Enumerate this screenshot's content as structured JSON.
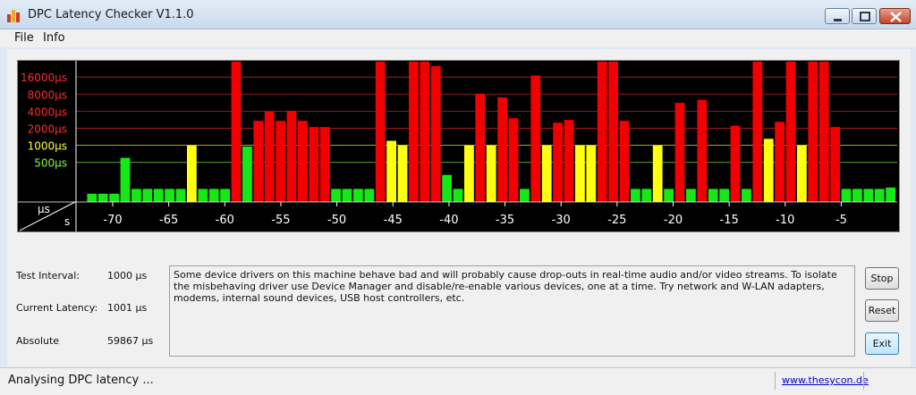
{
  "window": {
    "title": "DPC Latency Checker V1.1.0"
  },
  "menu": {
    "items": [
      {
        "label": "File"
      },
      {
        "label": "Info"
      }
    ]
  },
  "chart_data": {
    "type": "bar",
    "xlabel": "s",
    "ylabel": "µs",
    "x_ticks": [
      -70,
      -65,
      -60,
      -55,
      -50,
      -45,
      -40,
      -35,
      -30,
      -25,
      -20,
      -15,
      -10,
      -5
    ],
    "xlim": [
      -75,
      0
    ],
    "y_ticks": [
      {
        "value": 500,
        "label": "500µs",
        "color": "#7cff3c"
      },
      {
        "value": 1000,
        "label": "1000µs",
        "color": "#ffff40"
      },
      {
        "value": 2000,
        "label": "2000µs",
        "color": "#ff2a2a"
      },
      {
        "value": 4000,
        "label": "4000µs",
        "color": "#ff2a2a"
      },
      {
        "value": 8000,
        "label": "8000µs",
        "color": "#ff2a2a"
      },
      {
        "value": 16000,
        "label": "16000µs",
        "color": "#ff2a2a"
      }
    ],
    "scale": "log",
    "ymax": 30000,
    "colors": {
      "green": "#17e617",
      "yellow": "#ffff10",
      "red": "#f00000",
      "background": "#000000",
      "axis": "#ffffff"
    },
    "thresholds": {
      "yellow": 1000,
      "red": 2000
    },
    "bar_values": [
      140,
      140,
      140,
      600,
      170,
      170,
      170,
      170,
      170,
      1000,
      170,
      170,
      170,
      30000,
      950,
      2700,
      3900,
      2700,
      4000,
      2700,
      2100,
      2100,
      170,
      170,
      170,
      170,
      30000,
      1200,
      1000,
      30000,
      30000,
      25000,
      300,
      170,
      1000,
      8000,
      1000,
      7000,
      3000,
      170,
      17000,
      1000,
      2500,
      2800,
      1000,
      1000,
      30000,
      30000,
      2700,
      170,
      170,
      1000,
      170,
      5600,
      170,
      6300,
      170,
      170,
      2200,
      170,
      30000,
      1300,
      2600,
      30000,
      1000,
      30000,
      30000,
      2100,
      170,
      170,
      170,
      170,
      180
    ]
  },
  "info": {
    "test_interval_label": "Test Interval:",
    "test_interval_value": "1000 µs",
    "current_latency_label": "Current Latency:",
    "current_latency_value": "1001 µs",
    "absolute_label": "Absolute",
    "absolute_value": "59867 µs"
  },
  "message": "Some device drivers on this machine behave bad and will probably cause drop-outs in real-time audio and/or video streams. To isolate the misbehaving driver use Device Manager and disable/re-enable various devices, one at a time. Try network and W-LAN adapters, modems, internal sound devices, USB host controllers, etc.",
  "buttons": {
    "stop": "Stop",
    "reset": "Reset",
    "exit": "Exit"
  },
  "status": {
    "text": "Analysing DPC latency ...",
    "link": "www.thesycon.de"
  }
}
